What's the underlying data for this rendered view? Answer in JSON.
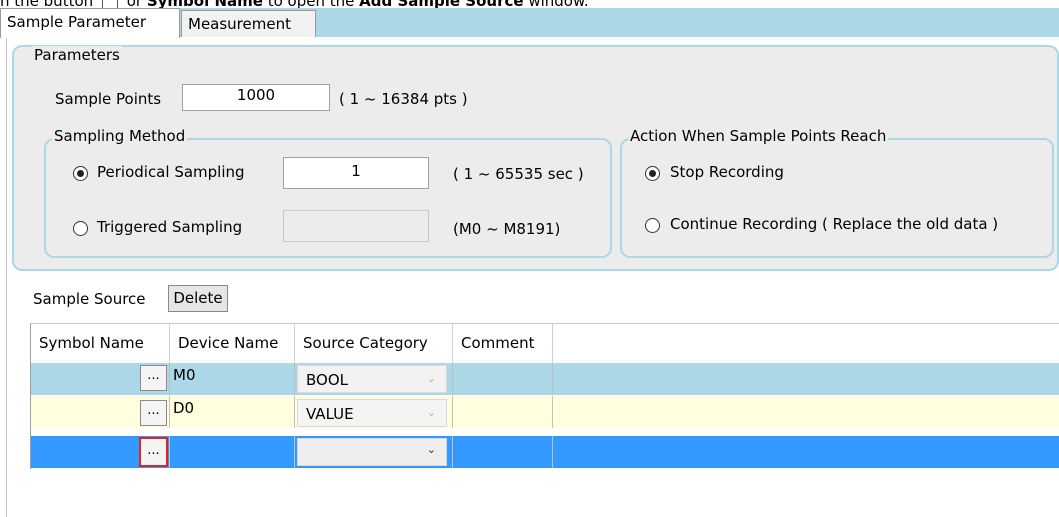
{
  "caption": {
    "part1": "n the button",
    "part2": "or",
    "part3": "Symbol Name",
    "part4": "to open the",
    "part5": "Add Sample Source",
    "part6": "window."
  },
  "tabs": [
    {
      "label": "Sample Parameter",
      "active": true
    },
    {
      "label": "Measurement",
      "active": false
    }
  ],
  "parameters": {
    "legend": "Parameters",
    "sample_points_label": "Sample Points",
    "sample_points_value": "1000",
    "sample_points_range": "( 1 ~ 16384 pts )"
  },
  "sampling_method": {
    "legend": "Sampling Method",
    "periodical_label": "Periodical Sampling",
    "periodical_value": "1",
    "periodical_range": "( 1 ~ 65535 sec )",
    "triggered_label": "Triggered Sampling",
    "triggered_value": "",
    "triggered_range": "(M0 ~ M8191)",
    "selected": "periodical"
  },
  "action": {
    "legend": "Action When Sample Points Reach",
    "stop_label": "Stop Recording",
    "continue_label": "Continue Recording ( Replace the old data )",
    "selected": "stop"
  },
  "sample_source": {
    "label": "Sample Source",
    "delete_label": "Delete"
  },
  "grid": {
    "columns": [
      "Symbol Name",
      "Device Name",
      "Source Category",
      "Comment"
    ],
    "ellipsis_label": "...",
    "rows": [
      {
        "symbol": "",
        "device": "M0",
        "category": "BOOL",
        "comment": "",
        "bg": "#acd7e6"
      },
      {
        "symbol": "",
        "device": "D0",
        "category": "VALUE",
        "comment": "",
        "bg": "#ffffde"
      },
      {
        "symbol": "",
        "device": "",
        "category": "",
        "comment": "",
        "bg": "#3399ff",
        "selected": true
      }
    ]
  },
  "colors": {
    "accent": "#acd7e6",
    "selected_row": "#3399ff",
    "alt_row": "#ffffde",
    "highlight_border": "#d9262a"
  }
}
